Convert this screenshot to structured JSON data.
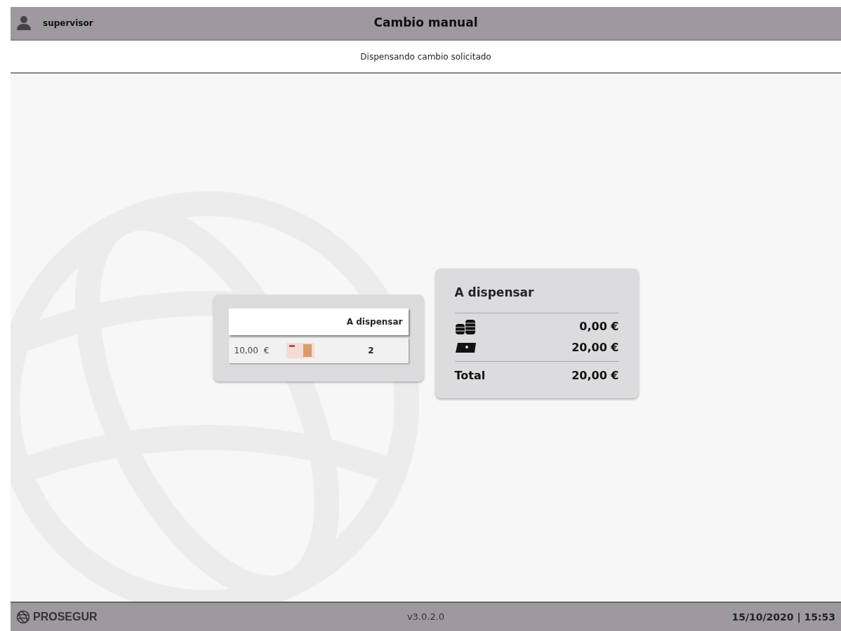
{
  "header": {
    "user": "supervisor",
    "title": "Cambio manual"
  },
  "status_message": "Dispensando cambio solicitado",
  "denominations_table": {
    "columns": [
      "A dispensar"
    ],
    "rows": [
      {
        "value": "10,00",
        "currency": "€",
        "kind": "note",
        "count": "2"
      }
    ]
  },
  "summary": {
    "title": "A dispensar",
    "lines": [
      {
        "kind": "coins",
        "amount": "0,00 €"
      },
      {
        "kind": "notes",
        "amount": "20,00 €"
      }
    ],
    "total_label": "Total",
    "total_amount": "20,00 €"
  },
  "footer": {
    "brand": "PROSEGUR",
    "version": "v3.0.2.0",
    "datetime": "15/10/2020 | 15:53"
  }
}
